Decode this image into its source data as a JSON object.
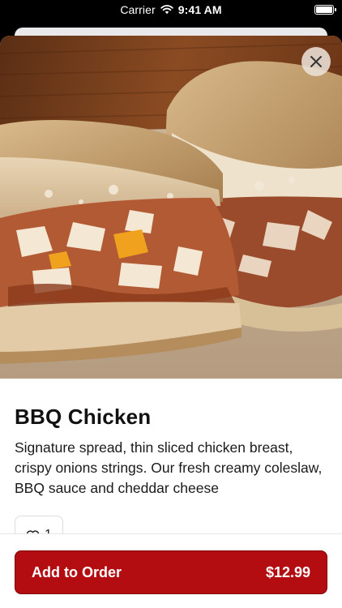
{
  "status_bar": {
    "carrier": "Carrier",
    "time": "9:41 AM"
  },
  "item": {
    "name": "BBQ Chicken",
    "description": "Signature spread, thin sliced chicken breast, crispy onions strings. Our fresh creamy coleslaw, BBQ sauce and cheddar cheese",
    "likes": "1",
    "image": "sandwich-photo"
  },
  "order": {
    "button_label": "Add to Order",
    "price": "$12.99"
  },
  "colors": {
    "accent": "#b30d12",
    "accent_border": "#7e0508"
  },
  "icons": {
    "close": "close-icon",
    "like": "heart-icon",
    "wifi": "wifi-icon",
    "battery": "battery-icon"
  }
}
